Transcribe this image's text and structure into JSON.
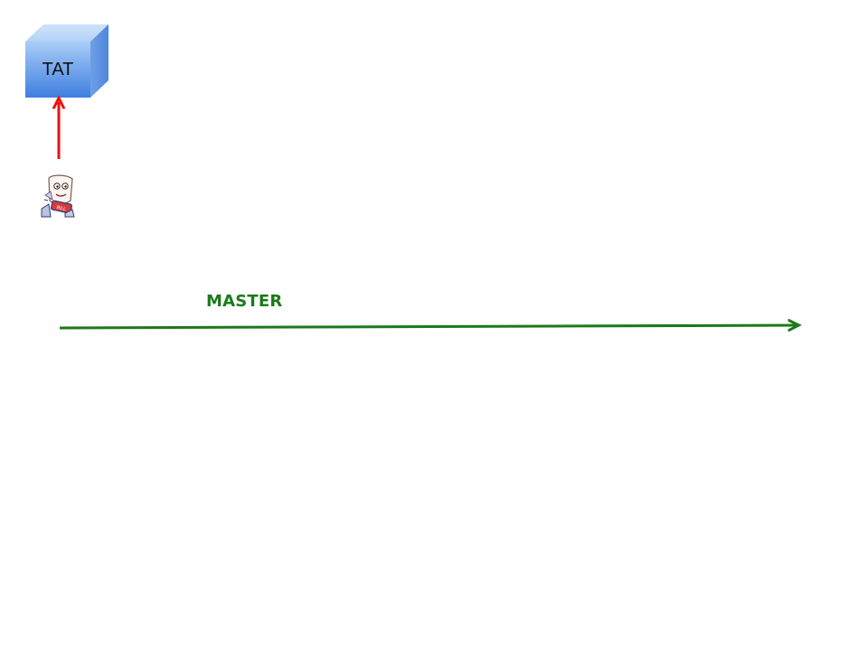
{
  "diagram": {
    "nodes": [
      {
        "id": "tat",
        "label": "TAT",
        "shape": "3d-box",
        "color": "#5b93e6"
      }
    ],
    "icons": [
      {
        "id": "bill-cartoon",
        "name": "cartoon-character-icon"
      }
    ],
    "arrows": [
      {
        "id": "up-arrow",
        "from": "bill-cartoon",
        "to": "tat",
        "color": "#ee1111"
      },
      {
        "id": "master-arrow",
        "label": "MASTER",
        "direction": "right",
        "color": "#1a7a1a"
      }
    ]
  }
}
